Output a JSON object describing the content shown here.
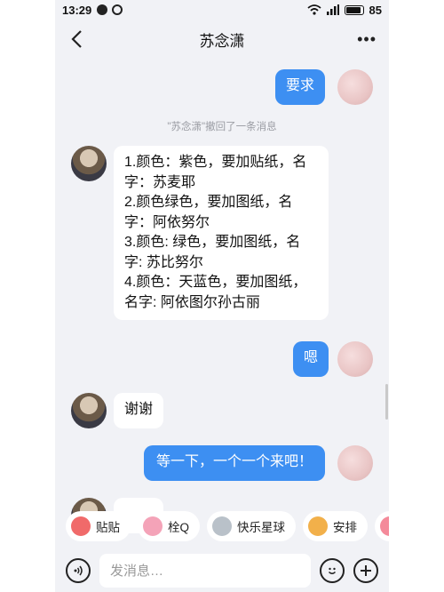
{
  "status_bar": {
    "time": "13:29",
    "battery": "85"
  },
  "header": {
    "title": "苏念潇"
  },
  "messages": {
    "m1": "要求",
    "recall": "\"苏念潇\"撤回了一条消息",
    "m2_lines": [
      "1.颜色：紫色，要加贴纸，名",
      "字：苏麦耶",
      "2.颜色绿色，要加图纸，名",
      "字：阿依努尔",
      "3.颜色: 绿色，要加图纸，名",
      "字: 苏比努尔",
      "4.颜色：天蓝色，要加图纸，",
      "名字: 阿依图尔孙古丽"
    ],
    "m3": "嗯",
    "m4": "谢谢",
    "m5": "等一下，一个一个来吧！"
  },
  "quick_replies": [
    {
      "label": "贴贴",
      "icon": "smiley-sticker-icon",
      "color": "#f06a6a"
    },
    {
      "label": "栓Q",
      "icon": "pig-sticker-icon",
      "color": "#f4a3b8"
    },
    {
      "label": "快乐星球",
      "icon": "planet-sticker-icon",
      "color": "#b9c1c9"
    },
    {
      "label": "安排",
      "icon": "dog-sticker-icon",
      "color": "#f2b04a"
    },
    {
      "label": "",
      "icon": "pig-face-sticker-icon",
      "color": "#f48a9a"
    }
  ],
  "input": {
    "placeholder": "发消息…"
  },
  "colors": {
    "accent": "#3d8ff2",
    "background": "#f1f2f6"
  }
}
